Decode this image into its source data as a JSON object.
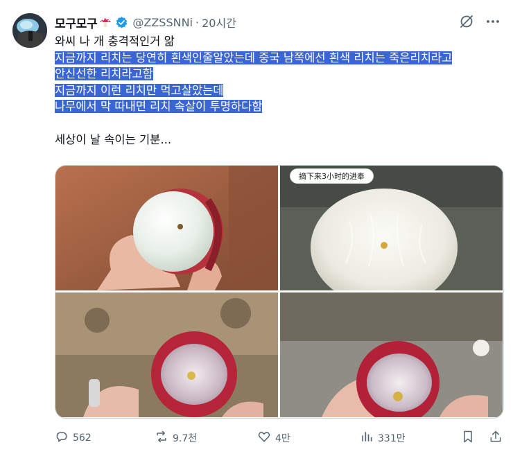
{
  "post": {
    "display_name": "모구모구",
    "handle": "@ZZSSNNi",
    "separator": "·",
    "time": "20시간",
    "text_line1": "와씨 나 개 충격적인거 앎",
    "highlighted_lines": [
      "지금까지 리치는 당연히 흰색인줄알았는데 중국 남쪽에선 흰색 리치는 죽은리치라고",
      "안신선한 리치라고함",
      "지금까지 이런 리치만 먹고살았는데",
      "나무에서 막 따내면 리치 속살이 투명하다함"
    ],
    "text_last": "세상이 날 속이는 기분...",
    "media_caption": "摘下来3小时的进奉"
  },
  "actions": {
    "replies": "562",
    "reposts": "9.7천",
    "likes": "4만",
    "views": "331만"
  },
  "icons": {
    "avatar": "avatar-image",
    "mushroom": "mushroom-emoji-icon",
    "verified": "verified-badge-icon",
    "grok": "grok-icon",
    "more": "more-icon",
    "reply": "reply-icon",
    "repost": "repost-icon",
    "like": "heart-icon",
    "views": "views-icon",
    "bookmark": "bookmark-icon",
    "share": "share-icon"
  },
  "colors": {
    "highlight": "#3a66d4",
    "verified": "#1d9bf0",
    "muted": "#536471"
  }
}
